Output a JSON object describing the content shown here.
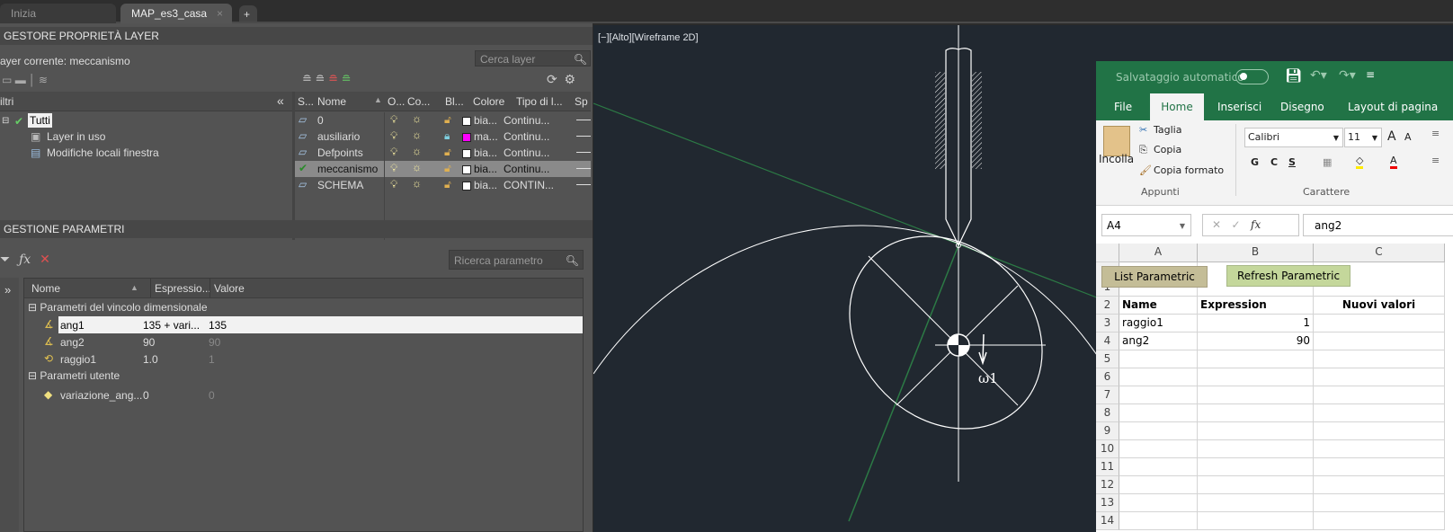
{
  "tabs": [
    {
      "label": "Inizia"
    },
    {
      "label": "MAP_es3_casa",
      "close": "×"
    },
    {
      "label": "+"
    }
  ],
  "layer_manager": {
    "title": "GESTORE PROPRIETÀ LAYER",
    "current_layer": "ayer corrente: meccanismo",
    "search_placeholder": "Cerca layer",
    "filters_label": "iltri",
    "collapse": "«",
    "filter_tree": [
      {
        "label": "Tutti"
      },
      {
        "label": "Layer in uso"
      },
      {
        "label": "Modifiche locali finestra"
      }
    ],
    "columns": [
      "S...",
      "Nome",
      "O...",
      "Co...",
      "Bl...",
      "Colore",
      "Tipo di l...",
      "Sp"
    ],
    "rows": [
      {
        "name": "0",
        "color": "bia...",
        "color_hex": "#ffffff",
        "linetype": "Continu...",
        "locked": false,
        "current": false
      },
      {
        "name": "ausiliario",
        "color": "ma...",
        "color_hex": "#ff00ff",
        "linetype": "Continu...",
        "locked": true,
        "current": false
      },
      {
        "name": "Defpoints",
        "color": "bia...",
        "color_hex": "#ffffff",
        "linetype": "Continu...",
        "locked": false,
        "current": false
      },
      {
        "name": "meccanismo",
        "color": "bia...",
        "color_hex": "#ffffff",
        "linetype": "Continu...",
        "locked": false,
        "current": true
      },
      {
        "name": "SCHEMA",
        "color": "bia...",
        "color_hex": "#ffffff",
        "linetype": "CONTIN...",
        "locked": false,
        "current": false
      }
    ]
  },
  "parameters": {
    "title": "GESTIONE PARAMETRI",
    "search_placeholder": "Ricerca parametro",
    "expand": "»",
    "columns": [
      "Nome",
      "Espressio...",
      "Valore"
    ],
    "group1": "Parametri del vincolo dimensionale",
    "group2": "Parametri utente",
    "rows": [
      {
        "name": "ang1",
        "expression": "135 + vari...",
        "value": "135",
        "selected": true
      },
      {
        "name": "ang2",
        "expression": "90",
        "value": "90"
      },
      {
        "name": "raggio1",
        "expression": "1.0",
        "value": "1"
      }
    ],
    "user_rows": [
      {
        "name": "variazione_ang...",
        "expression": "0",
        "value": "0"
      }
    ]
  },
  "viewport": {
    "label": "[−][Alto][Wireframe 2D]",
    "annotation": "ω1"
  },
  "excel": {
    "autosave": "Salvataggio automatico",
    "ribbon_tabs": [
      "File",
      "Home",
      "Inserisci",
      "Disegno",
      "Layout di pagina"
    ],
    "active_tab": "Home",
    "paste": "Incolla",
    "cut": "Taglia",
    "copy": "Copia",
    "format_painter": "Copia formato",
    "group_clipboard": "Appunti",
    "font": "Calibri",
    "font_size": "11",
    "bold": "G",
    "italic": "C",
    "underline": "S",
    "group_font": "Carattere",
    "name_box": "A4",
    "formula": "ang2",
    "fx": "fx",
    "col_headers": [
      "A",
      "B",
      "C"
    ],
    "btn_list": "List Parametric",
    "btn_refresh": "Refresh Parametric",
    "btn_list_color": "#c4bd97",
    "btn_refresh_color": "#c4d79b",
    "header_row": [
      "Name",
      "Expression",
      "Nuovi valori"
    ],
    "rows": [
      [
        "raggio1",
        "1",
        ""
      ],
      [
        "ang2",
        "90",
        ""
      ]
    ],
    "row_numbers": [
      "1",
      "2",
      "3",
      "4",
      "5",
      "6",
      "7",
      "8",
      "9",
      "10",
      "11",
      "12",
      "13",
      "14"
    ]
  }
}
